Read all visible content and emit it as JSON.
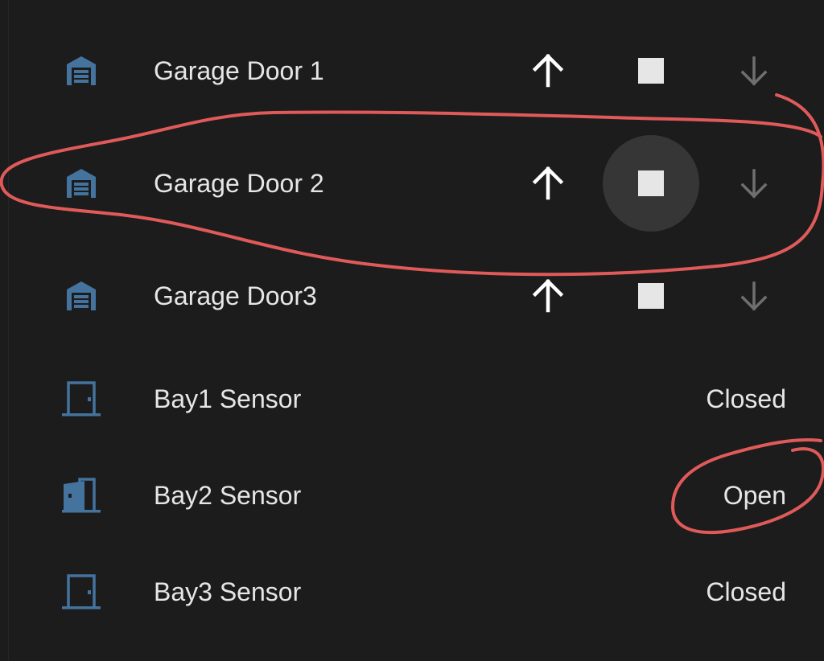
{
  "colors": {
    "background": "#1c1c1c",
    "icon_blue": "#44739e",
    "text": "#e6e6e6",
    "disabled": "#6f6f6f",
    "annotation": "#e05a5a"
  },
  "covers": [
    {
      "name": "Garage Door 1",
      "icon": "garage-icon",
      "open_icon": "arrow-up-icon",
      "stop_icon": "stop-icon",
      "close_icon": "arrow-down-icon"
    },
    {
      "name": "Garage Door 2",
      "icon": "garage-icon",
      "open_icon": "arrow-up-icon",
      "stop_icon": "stop-icon",
      "close_icon": "arrow-down-icon"
    },
    {
      "name": "Garage Door3",
      "icon": "garage-icon",
      "open_icon": "arrow-up-icon",
      "stop_icon": "stop-icon",
      "close_icon": "arrow-down-icon"
    }
  ],
  "sensors": [
    {
      "name": "Bay1 Sensor",
      "icon": "door-closed-icon",
      "state": "Closed"
    },
    {
      "name": "Bay2 Sensor",
      "icon": "door-open-icon",
      "state": "Open"
    },
    {
      "name": "Bay3 Sensor",
      "icon": "door-closed-icon",
      "state": "Closed"
    }
  ]
}
